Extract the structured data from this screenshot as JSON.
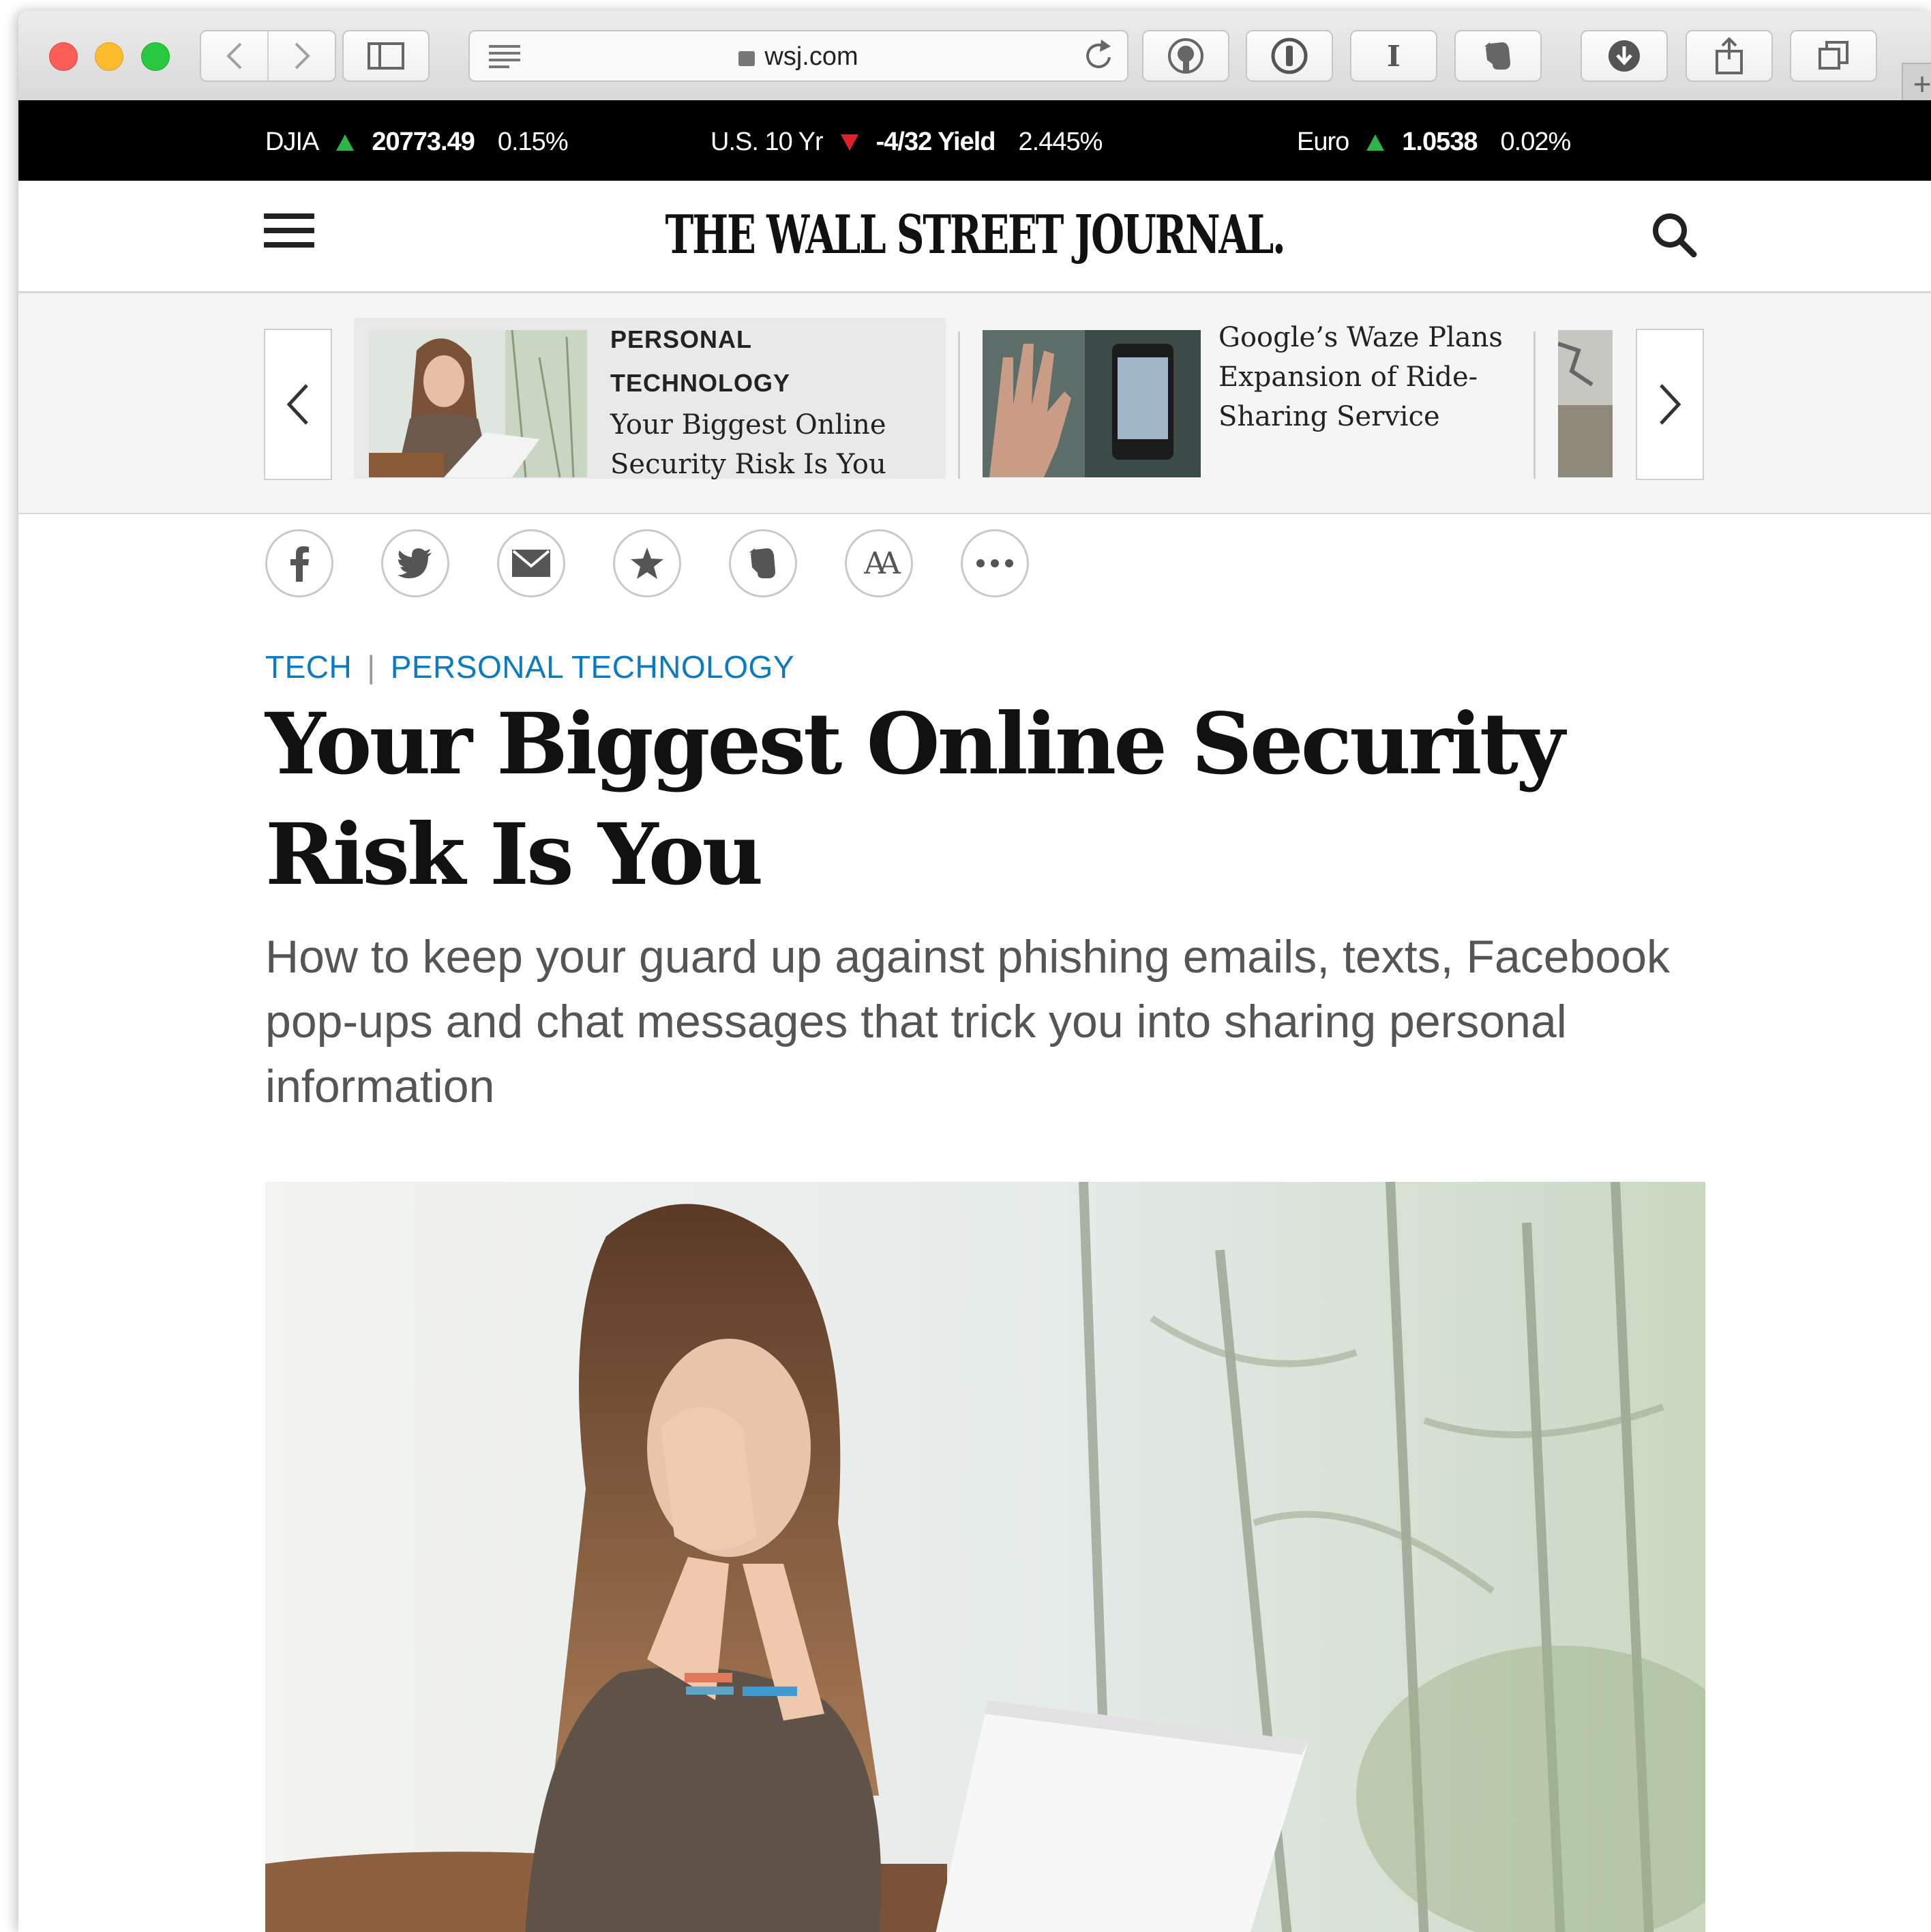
{
  "browser": {
    "url": "wsj.com",
    "toolbar_icons": [
      "back-icon",
      "forward-icon",
      "sidebar-icon",
      "reader-icon",
      "reload-icon",
      "duckduckgo-icon",
      "1password-icon",
      "instapaper-icon",
      "evernote-icon",
      "download-icon",
      "share-icon",
      "tabs-icon",
      "new-tab-icon"
    ],
    "new_tab_label": "+"
  },
  "ticker": [
    {
      "label": "DJIA",
      "direction": "up",
      "value": "20773.49",
      "change": "0.15%"
    },
    {
      "label": "U.S. 10 Yr",
      "direction": "down",
      "value": "-4/32 Yield",
      "change": "2.445%"
    },
    {
      "label": "Euro",
      "direction": "up",
      "value": "1.0538",
      "change": "0.02%"
    }
  ],
  "masthead": {
    "logo": "THE WALL STREET JOURNAL."
  },
  "carousel": {
    "items": [
      {
        "category": "PERSONAL TECHNOLOGY",
        "title": "Your Biggest Online Security Risk Is You"
      },
      {
        "category": "",
        "title": "Google’s Waze Plans Expansion of Ride-Sharing Service"
      }
    ]
  },
  "share_icons": [
    "facebook-icon",
    "twitter-icon",
    "email-icon",
    "save-star-icon",
    "evernote-icon",
    "text-size-icon",
    "more-icon"
  ],
  "text_size_label": "AA",
  "article": {
    "crumb_section": "TECH",
    "crumb_separator": "|",
    "crumb_subsection": "PERSONAL TECHNOLOGY",
    "headline": "Your Biggest Online Security Risk Is You",
    "dek": "How to keep your guard up against phishing emails, texts, Facebook pop-ups and chat messages that trick you into sharing personal information"
  },
  "colors": {
    "ticker_up": "#2fb34a",
    "ticker_down": "#e0212d",
    "link_blue": "#0a7bc2"
  }
}
